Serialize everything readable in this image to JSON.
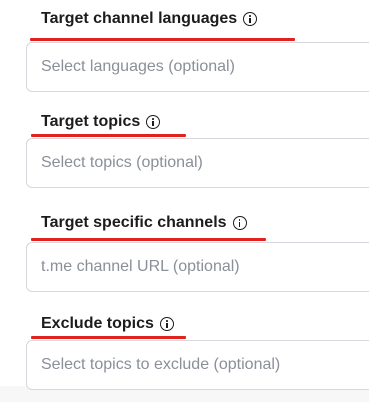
{
  "fields": [
    {
      "label": "Target channel languages",
      "placeholder": "Select languages (optional)",
      "info_icon": "info-icon"
    },
    {
      "label": "Target topics",
      "placeholder": "Select topics (optional)",
      "info_icon": "info-icon"
    },
    {
      "label": "Target specific channels",
      "placeholder": "t.me channel URL (optional)",
      "info_icon": "info-icon"
    },
    {
      "label": "Exclude topics",
      "placeholder": "Select topics to exclude (optional)",
      "info_icon": "info-icon"
    }
  ],
  "colors": {
    "highlight": "#e0231f",
    "label": "#1c1c1c",
    "placeholder": "#8a8f98",
    "border": "#d6d8dd"
  }
}
